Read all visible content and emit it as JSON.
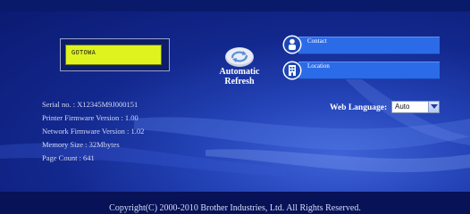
{
  "status": {
    "text": "GOTOWA"
  },
  "refresh": {
    "label_line1": "Automatic",
    "label_line2": "Refresh",
    "icon": "refresh-icon"
  },
  "links": {
    "contact": {
      "label": "Contact",
      "icon": "person-icon"
    },
    "location": {
      "label": "Location",
      "icon": "building-icon"
    }
  },
  "info": {
    "serial": "Serial no. : X12345M9J000151",
    "printer_fw": "Printer Firmware Version : 1.00",
    "network_fw": "Network Firmware Version : 1.02",
    "memory": "Memory Size : 32Mbytes",
    "page_count": "Page Count : 641"
  },
  "language": {
    "label": "Web Language:",
    "selected": "Auto"
  },
  "footer": {
    "copyright": "Copyright(C) 2000-2010 Brother Industries, Ltd. All Rights Reserved."
  },
  "colors": {
    "panel": "#13288e",
    "lcd": "#dff41f",
    "bar": "#2b6be8",
    "footer": "#071257"
  }
}
